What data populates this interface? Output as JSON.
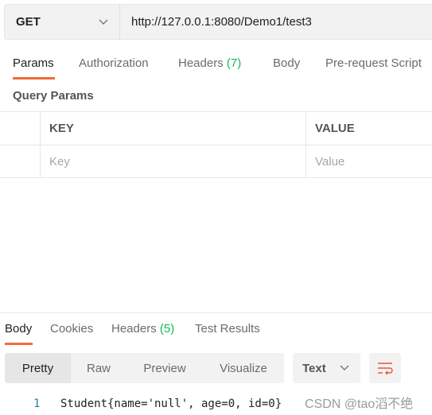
{
  "request": {
    "method": "GET",
    "url": "http://127.0.0.1:8080/Demo1/test3"
  },
  "request_tabs": [
    {
      "label": "Params",
      "active": true
    },
    {
      "label": "Authorization"
    },
    {
      "label": "Headers",
      "count": "(7)"
    },
    {
      "label": "Body"
    },
    {
      "label": "Pre-request Script"
    }
  ],
  "query_params": {
    "title": "Query Params",
    "columns": [
      "KEY",
      "VALUE"
    ],
    "placeholders": {
      "key": "Key",
      "value": "Value"
    }
  },
  "response_tabs": [
    {
      "label": "Body",
      "active": true
    },
    {
      "label": "Cookies"
    },
    {
      "label": "Headers",
      "count": "(5)"
    },
    {
      "label": "Test Results"
    }
  ],
  "view_modes": [
    "Pretty",
    "Raw",
    "Preview",
    "Visualize"
  ],
  "active_view": "Pretty",
  "format": "Text",
  "body_lines": [
    {
      "number": "1",
      "text": "Student{name='null', age=0, id=0}"
    }
  ],
  "watermark": "CSDN @tao滔不绝",
  "colors": {
    "accent": "#f26b3a",
    "count": "#0cbb52"
  },
  "icons": {
    "method_dropdown": "chevron-down-icon",
    "format_dropdown": "chevron-down-icon",
    "wrap": "wrap-lines-icon"
  }
}
